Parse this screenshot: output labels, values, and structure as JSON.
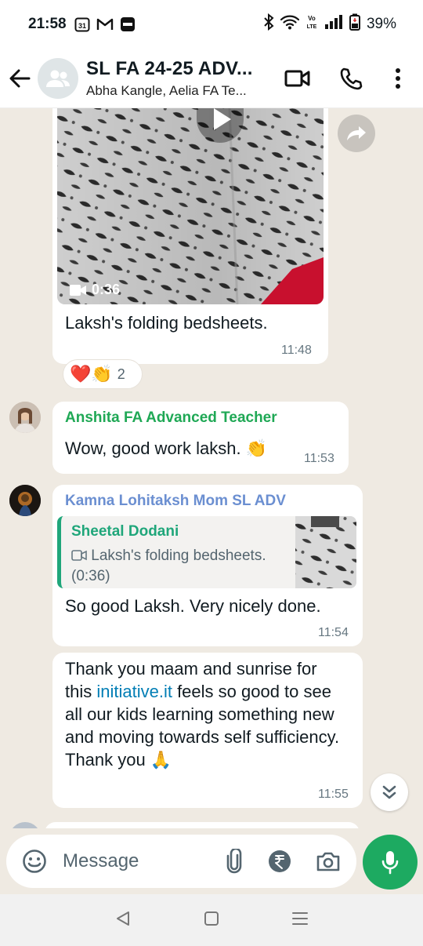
{
  "status_bar": {
    "time": "21:58",
    "calendar_badge": "31",
    "battery": "39%"
  },
  "header": {
    "title": "SL FA 24-25 ADV...",
    "subtitle": "Abha Kangle, Aelia FA Te..."
  },
  "messages": [
    {
      "type": "video",
      "duration": "0:36",
      "caption": "Laksh's folding bedsheets.",
      "time": "11:48",
      "reactions": {
        "emojis": "❤️👏",
        "count": "2"
      }
    },
    {
      "sender": "Anshita FA Advanced Teacher",
      "sender_color": "#1fa855",
      "text": "Wow, good work laksh. 👏",
      "time": "11:53"
    },
    {
      "sender": "Kamna Lohitaksh Mom SL ADV",
      "sender_color": "#6b8fd1",
      "quote": {
        "name": "Sheetal Dodani",
        "text": "Laksh's folding bedsheets. (0:36)"
      },
      "text": "So good Laksh. Very nicely done.",
      "time": "11:54"
    },
    {
      "text_before_link": "Thank you maam and sunrise for this ",
      "link": "initiative.it",
      "text_after_link": " feels so good to see all our kids learning something new and moving towards self sufficiency. Thank you 🙏",
      "time": "11:55"
    }
  ],
  "composer": {
    "placeholder": "Message"
  },
  "colors": {
    "accent_green": "#1daa61",
    "chat_bg": "#efeae2",
    "link": "#027eb5"
  }
}
